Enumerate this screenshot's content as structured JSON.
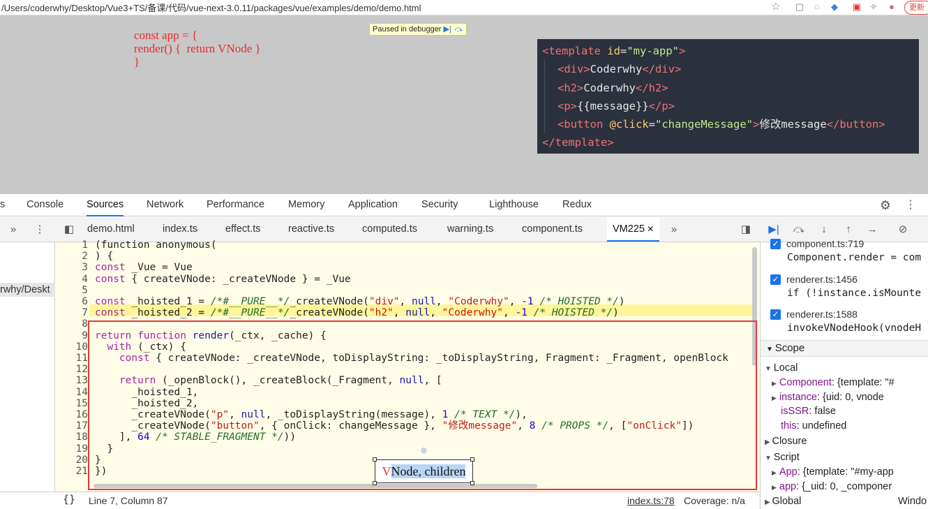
{
  "browser": {
    "url": "/Users/coderwhy/Desktop/Vue3+TS/备课/代码/vue-next-3.0.11/packages/vue/examples/demo/demo.html",
    "update_label": "更新"
  },
  "page": {
    "note_lines": [
      "const app = {",
      "render() {  return VNode }",
      "}"
    ],
    "paused_label": "Paused in debugger",
    "template_lines": [
      {
        "indent": 0,
        "parts": [
          [
            "tg",
            "<template"
          ],
          [
            "at",
            " id"
          ],
          [
            "tx",
            "="
          ],
          [
            "st",
            "\"my-app\""
          ],
          [
            "tg",
            ">"
          ]
        ]
      },
      {
        "indent": 1,
        "parts": [
          [
            "tg",
            "<div>"
          ],
          [
            "tx",
            "Coderwhy"
          ],
          [
            "tg",
            "</div>"
          ]
        ]
      },
      {
        "indent": 1,
        "parts": [
          [
            "tg",
            "<h2>"
          ],
          [
            "tx",
            "Coderwhy"
          ],
          [
            "tg",
            "</h2>"
          ]
        ]
      },
      {
        "indent": 1,
        "parts": [
          [
            "tg",
            "<p>"
          ],
          [
            "tx",
            "{{message}}"
          ],
          [
            "tg",
            "</p>"
          ]
        ]
      },
      {
        "indent": 1,
        "parts": [
          [
            "tg",
            "<button"
          ],
          [
            "at",
            " @click"
          ],
          [
            "tx",
            "="
          ],
          [
            "st",
            "\"changeMessage\""
          ],
          [
            "tg",
            ">"
          ],
          [
            "tx",
            "修改message"
          ],
          [
            "tg",
            "</button>"
          ]
        ]
      },
      {
        "indent": 0,
        "parts": [
          [
            "tg",
            "</template>"
          ]
        ]
      }
    ]
  },
  "devtools": {
    "panel_tabs": [
      "s",
      "Console",
      "Sources",
      "Network",
      "Performance",
      "Memory",
      "Application",
      "Security",
      "Lighthouse",
      "Redux"
    ],
    "active_panel": "Sources",
    "file_tabs": [
      "demo.html",
      "index.ts",
      "effect.ts",
      "reactive.ts",
      "computed.ts",
      "warning.ts",
      "component.ts",
      "VM225"
    ],
    "active_file": "VM225",
    "navigator_label": "rwhy/Deskt",
    "code_lines": [
      {
        "n": "1",
        "parts": [
          [
            "",
            "(function anonymous("
          ]
        ]
      },
      {
        "n": "2",
        "parts": [
          [
            "",
            ") {"
          ]
        ]
      },
      {
        "n": "3",
        "parts": [
          [
            "kw",
            "const"
          ],
          [
            "",
            " _Vue = Vue"
          ]
        ]
      },
      {
        "n": "4",
        "parts": [
          [
            "kw",
            "const"
          ],
          [
            "",
            " { createVNode: _createVNode } = _Vue"
          ]
        ]
      },
      {
        "n": "5",
        "parts": [
          [
            "",
            ""
          ]
        ]
      },
      {
        "n": "6",
        "parts": [
          [
            "kw",
            "const"
          ],
          [
            "",
            " _hoisted_1 = "
          ],
          [
            "c",
            "/*#__PURE__*/"
          ],
          [
            "",
            "_createVNode("
          ],
          [
            "s",
            "\"div\""
          ],
          [
            ",",
            ", "
          ],
          [
            "kb",
            "null"
          ],
          [
            "",
            ", "
          ],
          [
            "s",
            "\"Coderwhy\""
          ],
          [
            "",
            ", "
          ],
          [
            "n",
            "-1"
          ],
          [
            "",
            " "
          ],
          [
            "c",
            "/* HOISTED */"
          ],
          [
            "",
            ")"
          ]
        ]
      },
      {
        "n": "7",
        "parts": [
          [
            "kw",
            "const"
          ],
          [
            "",
            " _hoisted_2 = "
          ],
          [
            "c",
            "/*#__PURE__*/"
          ],
          [
            "",
            "_createVNode("
          ],
          [
            "s",
            "\"h2\""
          ],
          [
            "",
            ", "
          ],
          [
            "kb",
            "null"
          ],
          [
            "",
            ", "
          ],
          [
            "s",
            "\"Coderwhy\""
          ],
          [
            "",
            ", "
          ],
          [
            "n",
            "-1"
          ],
          [
            "",
            " "
          ],
          [
            "c",
            "/* HOISTED */"
          ],
          [
            "",
            ")"
          ]
        ]
      },
      {
        "n": "8",
        "parts": [
          [
            "",
            ""
          ]
        ]
      },
      {
        "n": "9",
        "parts": [
          [
            "kw",
            "return function"
          ],
          [
            "",
            " "
          ],
          [
            "v",
            "render"
          ],
          [
            "",
            "(_ctx, _cache) {"
          ]
        ]
      },
      {
        "n": "10",
        "parts": [
          [
            "",
            "  "
          ],
          [
            "kw",
            "with"
          ],
          [
            "",
            " (_ctx) {"
          ]
        ]
      },
      {
        "n": "11",
        "parts": [
          [
            "",
            "    "
          ],
          [
            "kw",
            "const"
          ],
          [
            "",
            " { createVNode: _createVNode, toDisplayString: _toDisplayString, Fragment: _Fragment, openBlock"
          ]
        ]
      },
      {
        "n": "12",
        "parts": [
          [
            "",
            ""
          ]
        ]
      },
      {
        "n": "13",
        "parts": [
          [
            "",
            "    "
          ],
          [
            "kw",
            "return"
          ],
          [
            "",
            " (_openBlock(), _createBlock(_Fragment, "
          ],
          [
            "kb",
            "null"
          ],
          [
            "",
            ", ["
          ]
        ]
      },
      {
        "n": "14",
        "parts": [
          [
            "",
            "      _hoisted_1,"
          ]
        ]
      },
      {
        "n": "15",
        "parts": [
          [
            "",
            "      _hoisted_2,"
          ]
        ]
      },
      {
        "n": "16",
        "parts": [
          [
            "",
            "      _createVNode("
          ],
          [
            "s",
            "\"p\""
          ],
          [
            "",
            ", "
          ],
          [
            "kb",
            "null"
          ],
          [
            "",
            ", _toDisplayString(message), "
          ],
          [
            "n",
            "1"
          ],
          [
            "",
            " "
          ],
          [
            "c",
            "/* TEXT */"
          ],
          [
            "",
            "),"
          ]
        ]
      },
      {
        "n": "17",
        "parts": [
          [
            "",
            "      _createVNode("
          ],
          [
            "s",
            "\"button\""
          ],
          [
            "",
            ", { onClick: changeMessage }, "
          ],
          [
            "s",
            "\"修改message\""
          ],
          [
            "",
            ", "
          ],
          [
            "n",
            "8"
          ],
          [
            "",
            " "
          ],
          [
            "c",
            "/* PROPS */"
          ],
          [
            "",
            ", ["
          ],
          [
            "s",
            "\"onClick\""
          ],
          [
            "",
            "])"
          ]
        ]
      },
      {
        "n": "18",
        "parts": [
          [
            "",
            "    ], "
          ],
          [
            "n",
            "64"
          ],
          [
            "",
            " "
          ],
          [
            "c",
            "/* STABLE_FRAGMENT */"
          ],
          [
            "",
            "))"
          ]
        ]
      },
      {
        "n": "19",
        "parts": [
          [
            "",
            "  }"
          ]
        ]
      },
      {
        "n": "20",
        "parts": [
          [
            "",
            "}"
          ]
        ]
      },
      {
        "n": "21",
        "parts": [
          [
            "",
            "})"
          ]
        ]
      }
    ],
    "highlighted_line": "7",
    "annotation": {
      "red": "V",
      "highlight": "Node, children"
    },
    "status": {
      "braces": "{}",
      "position": "Line 7, Column 87",
      "source_link": "index.ts:78",
      "coverage": "Coverage: n/a"
    },
    "breakpoints": [
      {
        "file": "component.ts:719",
        "code": "Component.render = com"
      },
      {
        "file": "renderer.ts:1456",
        "code": "if (!instance.isMounte"
      },
      {
        "file": "renderer.ts:1588",
        "code": "invokeVNodeHook(vnodeH"
      }
    ],
    "scope": {
      "title": "Scope",
      "local_label": "Local",
      "local": [
        {
          "arrow": "▶",
          "key": "Component",
          "val": ": {template: \"#"
        },
        {
          "arrow": "▶",
          "key": "instance",
          "val": ": {uid: 0, vnode"
        },
        {
          "arrow": "",
          "key": "isSSR",
          "val": ": false"
        },
        {
          "arrow": "",
          "key": "this",
          "val": ": undefined"
        }
      ],
      "closure_label": "Closure",
      "script_label": "Script",
      "script": [
        {
          "arrow": "▶",
          "key": "App",
          "val": ": {template: \"#my-app"
        },
        {
          "arrow": "▶",
          "key": "app",
          "val": ": {_uid: 0, _componer"
        }
      ],
      "global_label": "Global",
      "global_val": "Windo"
    }
  },
  "colors": {
    "accent": "#1a73e8",
    "annotation_border": "#e53935",
    "exec_line": "#fff59a"
  }
}
